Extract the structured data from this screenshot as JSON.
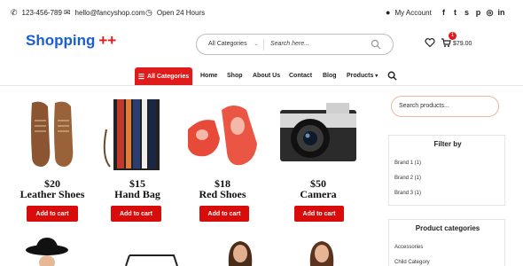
{
  "topbar": {
    "phone": "123-456-789",
    "email": "hello@fancyshop.com",
    "hours": "Open 24 Hours",
    "account": "My Account",
    "social_icons": [
      "facebook-icon",
      "twitter-icon",
      "skype-icon",
      "pinterest-icon",
      "instagram-icon",
      "linkedin-icon"
    ]
  },
  "header": {
    "logo_text": "Shopping",
    "logo_suffix": "++",
    "search_category": "All Categories",
    "search_placeholder": "Search here...",
    "cart_count": "1",
    "cart_total": "$79.00"
  },
  "nav": {
    "all_categories": "All Categories",
    "links": [
      "Home",
      "Shop",
      "About Us",
      "Contact",
      "Blog",
      "Products"
    ]
  },
  "products": [
    {
      "price": "$20",
      "name": "Leather Shoes",
      "button": "Add to cart"
    },
    {
      "price": "$15",
      "name": "Hand Bag",
      "button": "Add to cart"
    },
    {
      "price": "$18",
      "name": "Red Shoes",
      "button": "Add to cart"
    },
    {
      "price": "$50",
      "name": "Camera",
      "button": "Add to cart"
    }
  ],
  "sidebar": {
    "search_placeholder": "Search products...",
    "filter_title": "Filter by",
    "filter_items": [
      "Brand 1 (1)",
      "Brand 2 (1)",
      "Brand 3 (1)"
    ],
    "categories_title": "Product categories",
    "category_items": [
      "Accessories",
      "Child Category"
    ]
  },
  "colors": {
    "brand_blue": "#1a5fd0",
    "accent_red": "#e01b1b",
    "button_red": "#d90c0c"
  }
}
